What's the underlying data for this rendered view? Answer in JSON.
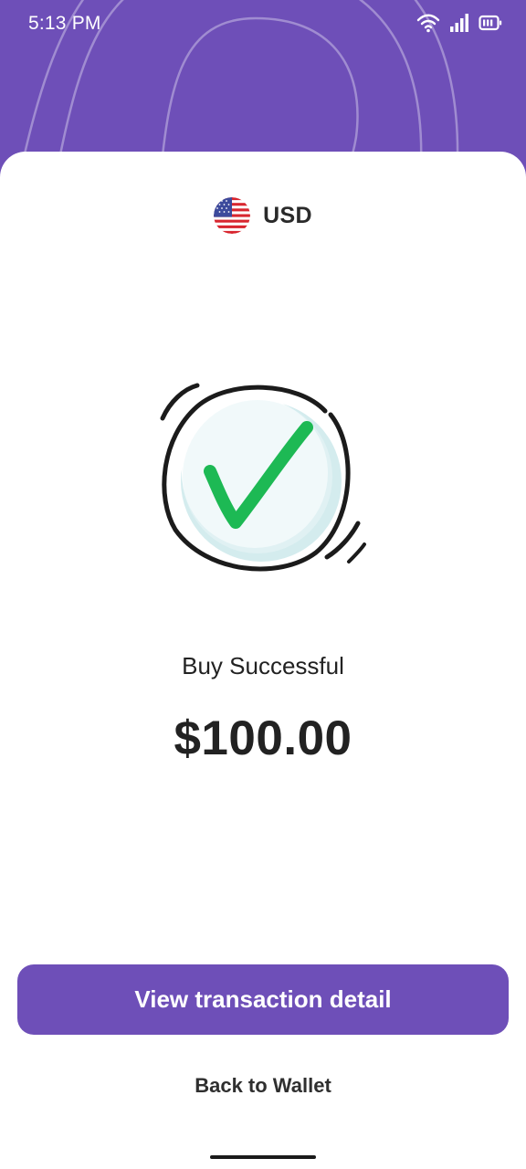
{
  "status_bar": {
    "time": "5:13 PM",
    "icons": [
      "wifi-icon",
      "signal-icon",
      "battery-icon"
    ]
  },
  "currency": {
    "code": "USD",
    "flag_icon": "us-flag-icon"
  },
  "illustration": {
    "icon": "success-check-icon"
  },
  "result": {
    "title": "Buy Successful",
    "amount": "$100.00"
  },
  "actions": {
    "primary_label": "View transaction detail",
    "secondary_label": "Back to Wallet"
  },
  "colors": {
    "brand": "#6e4fb8",
    "success": "#1db954",
    "text": "#222222"
  }
}
